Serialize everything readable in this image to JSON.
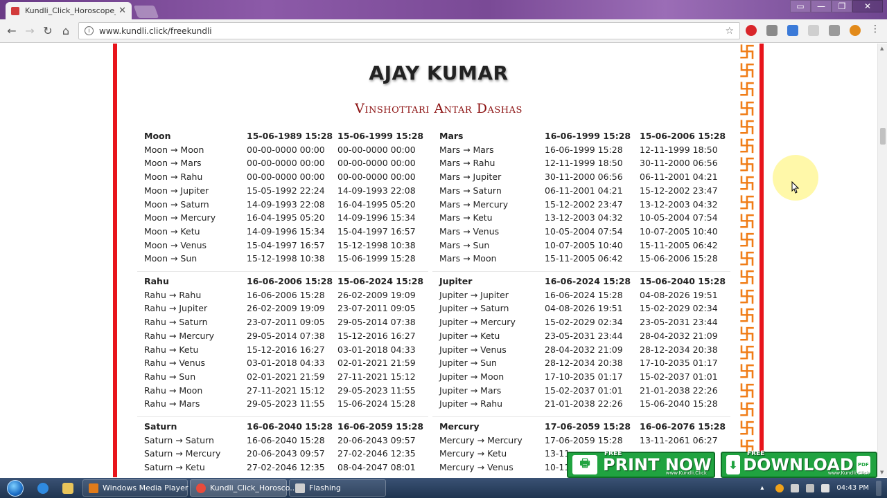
{
  "browser": {
    "tab_title": "Kundli_Click_Horoscope_",
    "tab_close": "✕",
    "url": "www.kundli.click/freekundli",
    "window_controls": [
      "▭",
      "—",
      "❐",
      "✕"
    ]
  },
  "page": {
    "person_name": "AJAY KUMAR",
    "section_title": "Vinshottari Antar Dashas"
  },
  "dasha_blocks": [
    {
      "id": "moon",
      "rows": [
        [
          "Moon",
          "15-06-1989 15:28",
          "15-06-1999 15:28"
        ],
        [
          "Moon → Moon",
          "00-00-0000 00:00",
          "00-00-0000 00:00"
        ],
        [
          "Moon → Mars",
          "00-00-0000 00:00",
          "00-00-0000 00:00"
        ],
        [
          "Moon → Rahu",
          "00-00-0000 00:00",
          "00-00-0000 00:00"
        ],
        [
          "Moon → Jupiter",
          "15-05-1992 22:24",
          "14-09-1993 22:08"
        ],
        [
          "Moon → Saturn",
          "14-09-1993 22:08",
          "16-04-1995 05:20"
        ],
        [
          "Moon → Mercury",
          "16-04-1995 05:20",
          "14-09-1996 15:34"
        ],
        [
          "Moon → Ketu",
          "14-09-1996 15:34",
          "15-04-1997 16:57"
        ],
        [
          "Moon → Venus",
          "15-04-1997 16:57",
          "15-12-1998 10:38"
        ],
        [
          "Moon → Sun",
          "15-12-1998 10:38",
          "15-06-1999 15:28"
        ]
      ]
    },
    {
      "id": "mars",
      "rows": [
        [
          "Mars",
          "16-06-1999 15:28",
          "15-06-2006 15:28"
        ],
        [
          "Mars → Mars",
          "16-06-1999 15:28",
          "12-11-1999 18:50"
        ],
        [
          "Mars → Rahu",
          "12-11-1999 18:50",
          "30-11-2000 06:56"
        ],
        [
          "Mars → Jupiter",
          "30-11-2000 06:56",
          "06-11-2001 04:21"
        ],
        [
          "Mars → Saturn",
          "06-11-2001 04:21",
          "15-12-2002 23:47"
        ],
        [
          "Mars → Mercury",
          "15-12-2002 23:47",
          "13-12-2003 04:32"
        ],
        [
          "Mars → Ketu",
          "13-12-2003 04:32",
          "10-05-2004 07:54"
        ],
        [
          "Mars → Venus",
          "10-05-2004 07:54",
          "10-07-2005 10:40"
        ],
        [
          "Mars → Sun",
          "10-07-2005 10:40",
          "15-11-2005 06:42"
        ],
        [
          "Mars → Moon",
          "15-11-2005 06:42",
          "15-06-2006 15:28"
        ]
      ]
    },
    {
      "id": "rahu",
      "rows": [
        [
          "Rahu",
          "16-06-2006 15:28",
          "15-06-2024 15:28"
        ],
        [
          "Rahu → Rahu",
          "16-06-2006 15:28",
          "26-02-2009 19:09"
        ],
        [
          "Rahu → Jupiter",
          "26-02-2009 19:09",
          "23-07-2011 09:05"
        ],
        [
          "Rahu → Saturn",
          "23-07-2011 09:05",
          "29-05-2014 07:38"
        ],
        [
          "Rahu → Mercury",
          "29-05-2014 07:38",
          "15-12-2016 16:27"
        ],
        [
          "Rahu → Ketu",
          "15-12-2016 16:27",
          "03-01-2018 04:33"
        ],
        [
          "Rahu → Venus",
          "03-01-2018 04:33",
          "02-01-2021 21:59"
        ],
        [
          "Rahu → Sun",
          "02-01-2021 21:59",
          "27-11-2021 15:12"
        ],
        [
          "Rahu → Moon",
          "27-11-2021 15:12",
          "29-05-2023 11:55"
        ],
        [
          "Rahu → Mars",
          "29-05-2023 11:55",
          "15-06-2024 15:28"
        ]
      ]
    },
    {
      "id": "jupiter",
      "rows": [
        [
          "Jupiter",
          "16-06-2024 15:28",
          "15-06-2040 15:28"
        ],
        [
          "Jupiter → Jupiter",
          "16-06-2024 15:28",
          "04-08-2026 19:51"
        ],
        [
          "Jupiter → Saturn",
          "04-08-2026 19:51",
          "15-02-2029 02:34"
        ],
        [
          "Jupiter → Mercury",
          "15-02-2029 02:34",
          "23-05-2031 23:44"
        ],
        [
          "Jupiter → Ketu",
          "23-05-2031 23:44",
          "28-04-2032 21:09"
        ],
        [
          "Jupiter → Venus",
          "28-04-2032 21:09",
          "28-12-2034 20:38"
        ],
        [
          "Jupiter → Sun",
          "28-12-2034 20:38",
          "17-10-2035 01:17"
        ],
        [
          "Jupiter → Moon",
          "17-10-2035 01:17",
          "15-02-2037 01:01"
        ],
        [
          "Jupiter → Mars",
          "15-02-2037 01:01",
          "21-01-2038 22:26"
        ],
        [
          "Jupiter → Rahu",
          "21-01-2038 22:26",
          "15-06-2040 15:28"
        ]
      ]
    },
    {
      "id": "saturn",
      "rows": [
        [
          "Saturn",
          "16-06-2040 15:28",
          "16-06-2059 15:28"
        ],
        [
          "Saturn → Saturn",
          "16-06-2040 15:28",
          "20-06-2043 09:57"
        ],
        [
          "Saturn → Mercury",
          "20-06-2043 09:57",
          "27-02-2046 12:35"
        ],
        [
          "Saturn → Ketu",
          "27-02-2046 12:35",
          "08-04-2047 08:01"
        ]
      ]
    },
    {
      "id": "mercury",
      "rows": [
        [
          "Mercury",
          "17-06-2059 15:28",
          "16-06-2076 15:28"
        ],
        [
          "Mercury → Mercury",
          "17-06-2059 15:28",
          "13-11-2061 06:27"
        ],
        [
          "Mercury → Ketu",
          "13-11-",
          ""
        ],
        [
          "Mercury → Venus",
          "10-11-",
          ""
        ]
      ]
    }
  ],
  "promo": {
    "print_tag": "FREE",
    "print_label": "PRINT NOW",
    "print_sub": "www.Kundli.Click",
    "download_tag": "FREE",
    "download_label": "DOWNLOAD",
    "download_sub": "www.Kundli.Click",
    "pdf_badge": "PDF"
  },
  "taskbar": {
    "items": [
      "Windows Media Player",
      "Kundli_Click_Horosco...",
      "Flashing"
    ],
    "clock": "04:43 PM"
  },
  "icons": {
    "swastika": "卐",
    "back": "←",
    "forward": "→",
    "reload": "↻",
    "home": "⌂",
    "info": "i",
    "star": "☆",
    "printer": "🖶",
    "scroll_up": "▲",
    "scroll_down": "▼"
  },
  "colors": {
    "border_red": "#e8141b",
    "swastika_orange": "#f07c16",
    "title_maroon": "#8b0f0f",
    "promo_green": "#20a340"
  }
}
